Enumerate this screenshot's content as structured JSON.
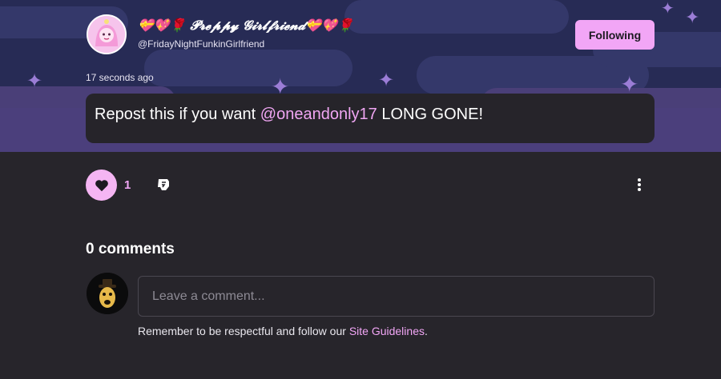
{
  "post": {
    "display_name": "💝💖🌹 𝓟𝓻𝓮𝓹𝓹𝔂 𝓖𝓲𝓻𝓵𝓯𝓻𝓲𝓮𝓷𝓭💝💖🌹",
    "handle": "@FridayNightFunkinGirlfriend",
    "timestamp": "17 seconds ago",
    "follow_label": "Following",
    "text_before": "Repost this if you want ",
    "mention": "@oneandonly17",
    "text_after": "  LONG GONE!"
  },
  "actions": {
    "like_count": "1",
    "like_icon": "heart-icon",
    "repost_icon": "repost-icon",
    "more_icon": "more-vertical-icon"
  },
  "comments": {
    "title": "0 comments",
    "input_placeholder": "Leave a comment...",
    "guidelines_prefix": "Remember to be respectful and follow our ",
    "guidelines_link": "Site Guidelines",
    "guidelines_suffix": "."
  },
  "colors": {
    "accent": "#f2a6f6",
    "background": "#27252b",
    "banner": "#272b55"
  }
}
